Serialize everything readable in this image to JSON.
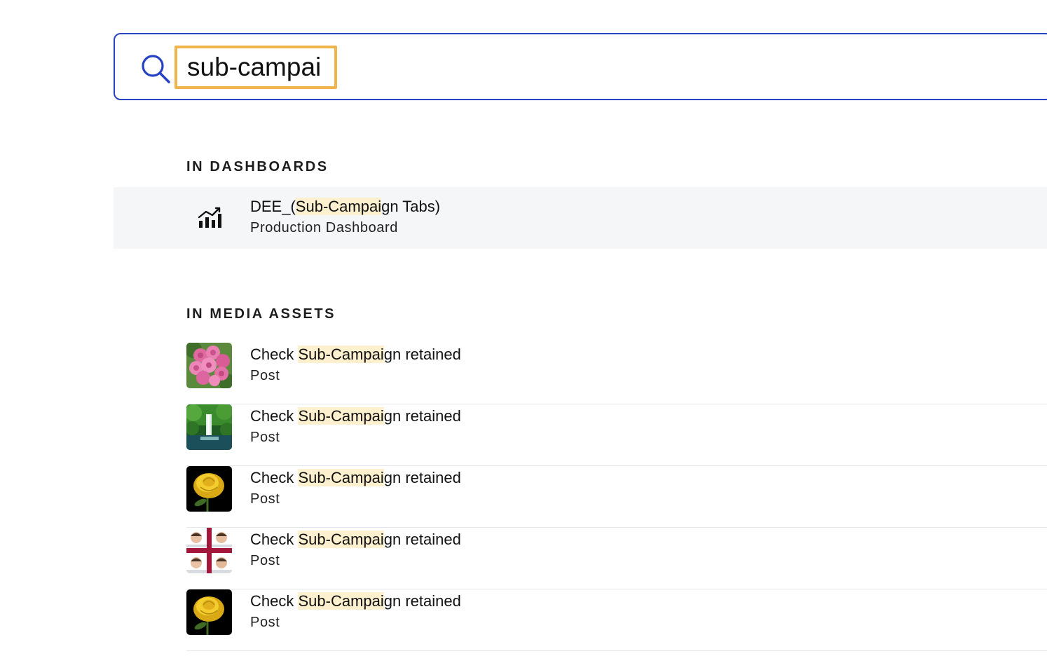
{
  "search": {
    "query": "sub-campai"
  },
  "dashboards": {
    "heading": "IN DASHBOARDS",
    "items": [
      {
        "title_pre": "DEE_(",
        "title_match": "Sub-Campai",
        "title_post": "gn Tabs)",
        "subtitle": "Production Dashboard",
        "icon": "chart-icon"
      }
    ]
  },
  "media": {
    "heading": "IN MEDIA ASSETS",
    "items": [
      {
        "title_pre": "Check ",
        "title_match": "Sub-Campai",
        "title_post": "gn retained",
        "subtitle": "Post",
        "thumb": "pink-roses-thumbnail"
      },
      {
        "title_pre": "Check ",
        "title_match": "Sub-Campai",
        "title_post": "gn retained",
        "subtitle": "Post",
        "thumb": "waterfall-thumbnail"
      },
      {
        "title_pre": "Check ",
        "title_match": "Sub-Campai",
        "title_post": "gn retained",
        "subtitle": "Post",
        "thumb": "yellow-rose-thumbnail"
      },
      {
        "title_pre": "Check ",
        "title_match": "Sub-Campai",
        "title_post": "gn retained",
        "subtitle": "Post",
        "thumb": "baby-collage-thumbnail"
      },
      {
        "title_pre": "Check ",
        "title_match": "Sub-Campai",
        "title_post": "gn retained",
        "subtitle": "Post",
        "thumb": "yellow-rose-thumbnail"
      }
    ]
  },
  "colors": {
    "accent": "#2743c4",
    "focus_outline": "#efb54b",
    "highlight": "#fdf0cf"
  }
}
